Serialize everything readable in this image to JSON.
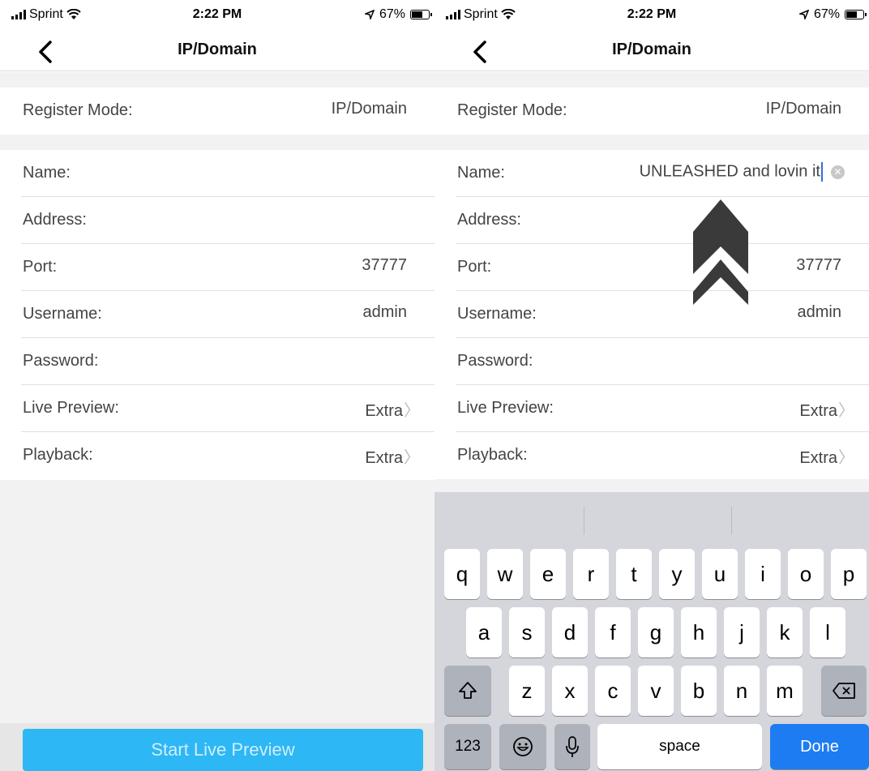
{
  "left": {
    "status": {
      "carrier": "Sprint",
      "time": "2:22 PM",
      "battery": "67%",
      "battery_level": 0.67
    },
    "nav": {
      "title": "IP/Domain"
    },
    "register_mode": {
      "label": "Register Mode:",
      "value": "IP/Domain"
    },
    "fields": [
      {
        "label": "Name:",
        "value": ""
      },
      {
        "label": "Address:",
        "value": ""
      },
      {
        "label": "Port:",
        "value": "37777"
      },
      {
        "label": "Username:",
        "value": "admin"
      },
      {
        "label": "Password:",
        "value": ""
      },
      {
        "label": "Live Preview:",
        "value": "Extra"
      },
      {
        "label": "Playback:",
        "value": "Extra"
      }
    ],
    "cta": "Start Live Preview"
  },
  "right": {
    "status": {
      "carrier": "Sprint",
      "time": "2:22 PM",
      "battery": "67%",
      "battery_level": 0.67
    },
    "nav": {
      "title": "IP/Domain"
    },
    "register_mode": {
      "label": "Register Mode:",
      "value": "IP/Domain"
    },
    "fields": [
      {
        "label": "Name:",
        "value": "UNLEASHED and lovin it"
      },
      {
        "label": "Address:",
        "value": ""
      },
      {
        "label": "Port:",
        "value": "37777"
      },
      {
        "label": "Username:",
        "value": "admin"
      },
      {
        "label": "Password:",
        "value": ""
      },
      {
        "label": "Live Preview:",
        "value": "Extra"
      },
      {
        "label": "Playback:",
        "value": "Extra"
      }
    ],
    "keyboard": {
      "row1": [
        "q",
        "w",
        "e",
        "r",
        "t",
        "y",
        "u",
        "i",
        "o",
        "p"
      ],
      "row2": [
        "a",
        "s",
        "d",
        "f",
        "g",
        "h",
        "j",
        "k",
        "l"
      ],
      "row3": [
        "z",
        "x",
        "c",
        "v",
        "b",
        "n",
        "m"
      ],
      "numbers_key": "123",
      "space_key": "space",
      "done_key": "Done"
    }
  },
  "icons": {
    "back": "chevron-left-icon",
    "chevron": "chevron-right-icon",
    "clear": "clear-text-icon",
    "annotation": "double-arrow-up-icon",
    "shift": "shift-icon",
    "backspace": "backspace-icon",
    "emoji": "emoji-icon",
    "mic": "microphone-icon"
  },
  "colors": {
    "cta": "#2db7f5",
    "done": "#1d7cf2",
    "annotation_arrow": "#3a3a3a"
  }
}
